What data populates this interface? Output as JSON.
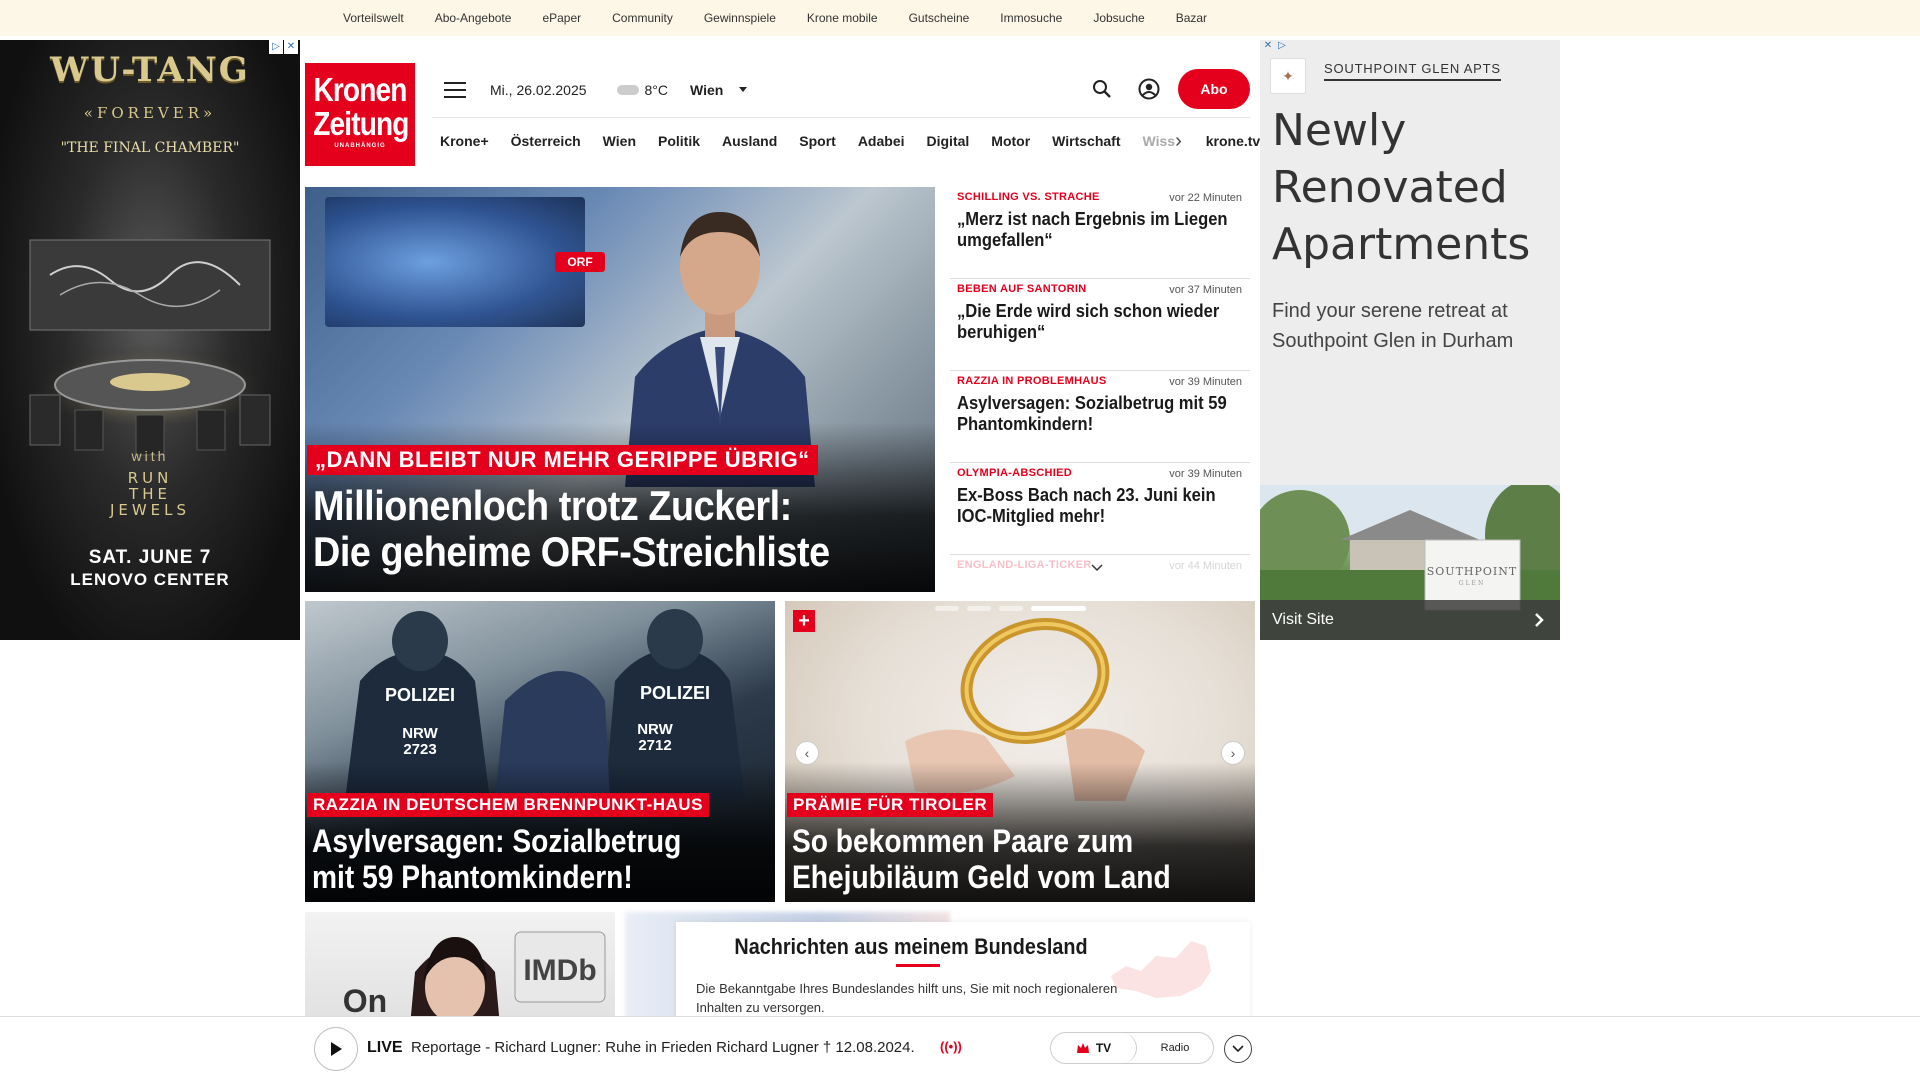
{
  "topbar": {
    "links": [
      "Vorteilswelt",
      "Abo-Angebote",
      "ePaper",
      "Community",
      "Gewinnspiele",
      "Krone mobile",
      "Gutscheine",
      "Immosuche",
      "Jobsuche",
      "Bazar"
    ]
  },
  "ad_left": {
    "title": "WU-TANG",
    "forever": "«FOREVER»",
    "subtitle": "\"THE FINAL CHAMBER\"",
    "with": "with",
    "act": [
      "RUN",
      "THE",
      "JEWELS"
    ],
    "date": "SAT. JUNE 7",
    "venue": "LENOVO CENTER"
  },
  "logo": {
    "line1": "Kronen",
    "line2": "Zeitung",
    "tagline": "UNABHÄNGIG"
  },
  "header": {
    "date": "Mi., 26.02.2025",
    "temperature": "8°C",
    "city": "Wien",
    "abo_label": "Abo"
  },
  "nav": {
    "items": [
      "Krone+",
      "Österreich",
      "Wien",
      "Politik",
      "Ausland",
      "Sport",
      "Adabei",
      "Digital",
      "Motor",
      "Wirtschaft"
    ],
    "truncated": "Wiss",
    "tv": "krone.tv"
  },
  "hero": {
    "kicker": "„DANN BLEIBT NUR MEHR GERIPPE ÜBRIG“",
    "headline_line1": "Millionenloch trotz Zuckerl:",
    "headline_line2": "Die geheime ORF-Streichliste",
    "screen_badge": "ORF"
  },
  "ticker": [
    {
      "category": "SCHILLING VS. STRACHE",
      "time": "vor 22 Minuten",
      "headline": "„Merz ist nach Ergebnis im Liegen umgefallen“"
    },
    {
      "category": "BEBEN AUF SANTORIN",
      "time": "vor 37 Minuten",
      "headline": "„Die Erde wird sich schon wieder beruhigen“"
    },
    {
      "category": "RAZZIA IN PROBLEMHAUS",
      "time": "vor 39 Minuten",
      "headline": "Asylversagen: Sozialbetrug mit 59 Phantomkindern!"
    },
    {
      "category": "OLYMPIA-ABSCHIED",
      "time": "vor 39 Minuten",
      "headline": "Ex-Boss Bach nach 23. Juni kein IOC-Mitglied mehr!"
    },
    {
      "category": "ENGLAND-LIGA-TICKER",
      "time": "vor 44 Minuten",
      "headline": ""
    }
  ],
  "ad_right": {
    "brand": "SOUTHPOINT GLEN APTS",
    "headline": "Newly Renovated Apartments",
    "sub": "Find your serene retreat at Southpoint Glen in Durham",
    "sign": "SOUTHPOINT",
    "sign_sub": "GLEN",
    "cta": "Visit Site"
  },
  "cards": [
    {
      "kicker": "RAZZIA IN DEUTSCHEM BRENNPUNKT-HAUS",
      "line1": "Asylversagen: Sozialbetrug",
      "line2": "mit 59 Phantomkindern!",
      "badge1": "POLIZEI",
      "badge1b": "NRW",
      "badge1c": "2723",
      "badge2": "POLIZEI",
      "badge2b": "NRW",
      "badge2c": "2712"
    },
    {
      "kicker": "PRÄMIE FÜR TIROLER",
      "line1": "So bekommen Paare zum",
      "line2": "Ehejubiläum Geld vom Land",
      "plus": "+"
    }
  ],
  "bundesland": {
    "title": "Nachrichten aus meinem Bundesland",
    "text": "Die Bekanntgabe Ihres Bundeslandes hilft uns, Sie mit noch regionaleren Inhalten zu versorgen."
  },
  "thumb1": {
    "sign": "IMDb",
    "sign2": "On"
  },
  "livebar": {
    "label": "LIVE",
    "text": "Reportage - Richard Lugner: Ruhe in Frieden Richard Lugner † 12.08.2024.",
    "tv": "TV",
    "radio": "Radio"
  },
  "colors": {
    "brand_red": "#e4001c",
    "topbar_bg": "#fdf7e7"
  }
}
